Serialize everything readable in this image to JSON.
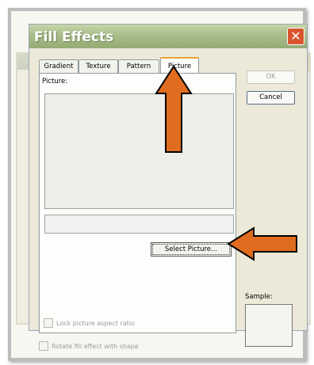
{
  "dialog": {
    "title": "Fill Effects",
    "close_label": "✕"
  },
  "tabs": [
    {
      "label": "Gradient"
    },
    {
      "label": "Texture"
    },
    {
      "label": "Pattern"
    },
    {
      "label": "Picture"
    }
  ],
  "active_tab": "Picture",
  "picture_panel": {
    "picture_label": "Picture:",
    "select_button": "Select Picture...",
    "lock_aspect_label": "Lock picture aspect ratio"
  },
  "buttons": {
    "ok": "OK",
    "cancel": "Cancel"
  },
  "sample_label": "Sample:",
  "rotate_label": "Rotate fill effect with shape",
  "colors": {
    "title_bar": "#a9bd8a",
    "close_button": "#d9552f",
    "arrow_fill": "#e06d1f",
    "arrow_stroke": "#000000",
    "active_tab_accent": "#e8a236"
  }
}
